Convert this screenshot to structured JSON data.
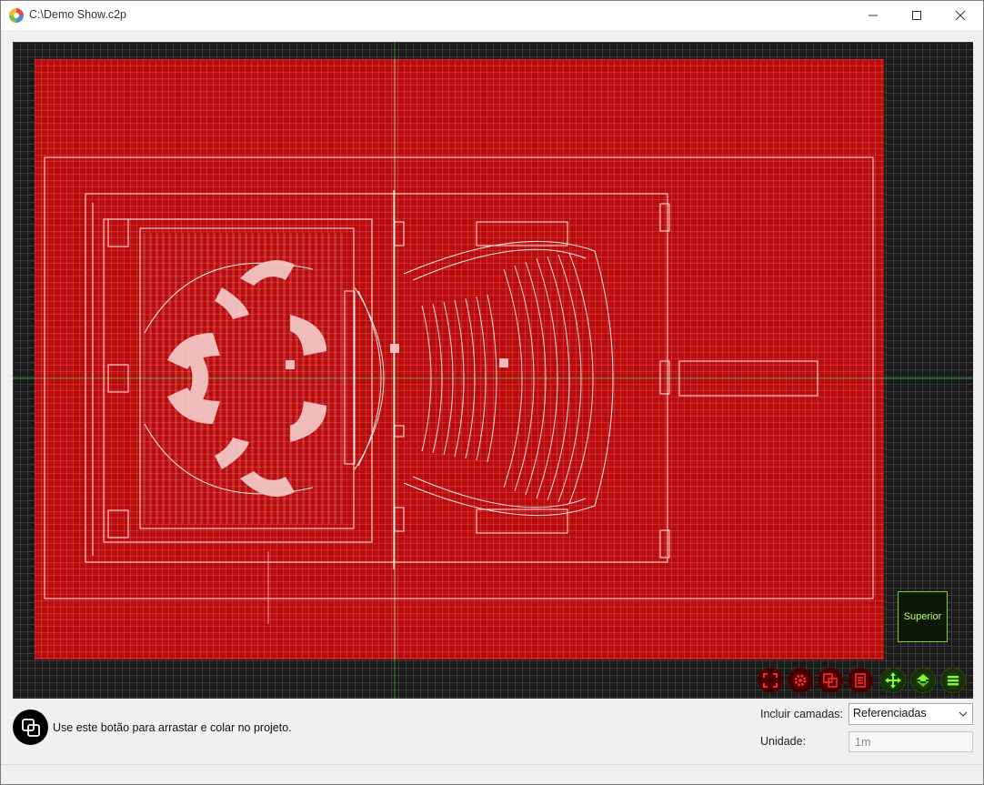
{
  "window": {
    "title": "C:\\Demo Show.c2p"
  },
  "viewport": {
    "view_label": "Superior",
    "colors": {
      "background": "#1a1a1a",
      "stage_area": "#b90d0d",
      "plan_lines": "#ffffff",
      "axis_green": "#3bb33b",
      "button_red": "#ff2a2a",
      "button_green": "#7cff2a"
    },
    "toolbar_icons": [
      "zoom-extents-icon",
      "settings-gear-icon",
      "copy-paste-icon",
      "document-icon",
      "pan-move-icon",
      "rotate-view-icon",
      "menu-icon"
    ]
  },
  "footer": {
    "drag_hint": "Use este botão para arrastar e colar no projeto.",
    "layers_label": "Incluir camadas:",
    "layers_value": "Referenciadas",
    "unit_label": "Unidade:",
    "unit_value": "1m"
  }
}
